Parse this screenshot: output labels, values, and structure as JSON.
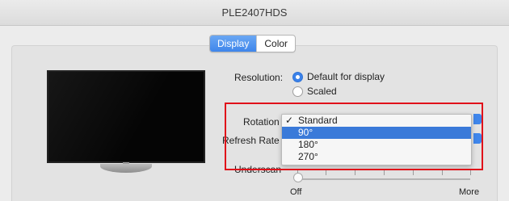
{
  "window": {
    "title": "PLE2407HDS"
  },
  "tabs": [
    {
      "label": "Display",
      "active": true
    },
    {
      "label": "Color",
      "active": false
    }
  ],
  "resolution": {
    "label": "Resolution:",
    "options": [
      {
        "label": "Default for display",
        "selected": true
      },
      {
        "label": "Scaled",
        "selected": false
      }
    ]
  },
  "rotation": {
    "label": "Rotation",
    "menu_items": [
      {
        "label": "Standard",
        "checked": true,
        "highlighted": false
      },
      {
        "label": "90°",
        "checked": false,
        "highlighted": true
      },
      {
        "label": "180°",
        "checked": false,
        "highlighted": false
      },
      {
        "label": "270°",
        "checked": false,
        "highlighted": false
      }
    ]
  },
  "refresh_rate": {
    "label": "Refresh Rate"
  },
  "underscan": {
    "label": "Underscan",
    "min_label": "Off",
    "max_label": "More",
    "value": 0
  },
  "colors": {
    "accent": "#3f86eb",
    "menu_highlight": "#3a7ad9",
    "annotation_box": "#e0111a"
  }
}
